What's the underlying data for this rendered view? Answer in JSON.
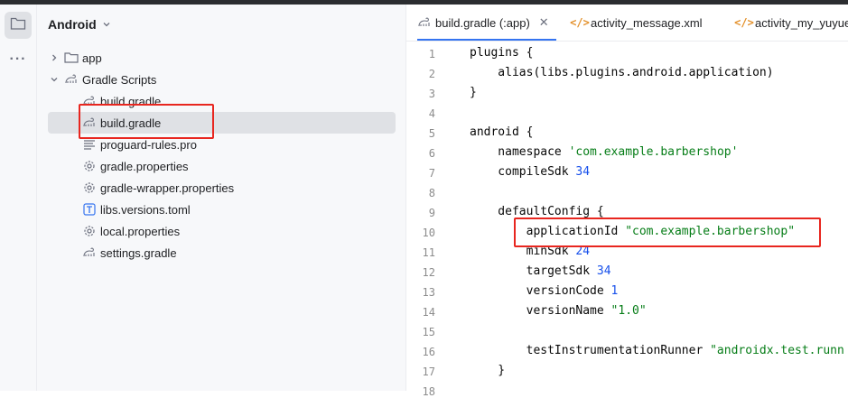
{
  "project_panel": {
    "title": "Android",
    "tree": [
      {
        "label": "app",
        "expanded": false,
        "icon": "folder-icon"
      },
      {
        "label": "Gradle Scripts",
        "expanded": true,
        "icon": "gradle-icon"
      },
      {
        "label": "build.gradle",
        "icon": "gradle-icon"
      },
      {
        "label": "build.gradle",
        "icon": "gradle-icon",
        "selected": true
      },
      {
        "label": "proguard-rules.pro",
        "icon": "text-file-icon"
      },
      {
        "label": "gradle.properties",
        "icon": "gear-icon"
      },
      {
        "label": "gradle-wrapper.properties",
        "icon": "gear-icon"
      },
      {
        "label": "libs.versions.toml",
        "icon": "toml-icon"
      },
      {
        "label": "local.properties",
        "icon": "gear-icon"
      },
      {
        "label": "settings.gradle",
        "icon": "gradle-icon"
      }
    ]
  },
  "tabs": [
    {
      "label": "build.gradle (:app)",
      "active": true,
      "icon": "gradle-icon"
    },
    {
      "label": "activity_message.xml",
      "icon": "xml-icon"
    },
    {
      "label": "activity_my_yuyue.",
      "icon": "xml-icon"
    }
  ],
  "editor": {
    "lines": [
      {
        "n": "1",
        "tokens": [
          {
            "t": "plugins {"
          }
        ]
      },
      {
        "n": "2",
        "tokens": [
          {
            "t": "    alias(libs.plugins.android.application)"
          }
        ]
      },
      {
        "n": "3",
        "tokens": [
          {
            "t": "}"
          }
        ]
      },
      {
        "n": "4",
        "tokens": []
      },
      {
        "n": "5",
        "tokens": [
          {
            "t": "android {"
          }
        ]
      },
      {
        "n": "6",
        "tokens": [
          {
            "t": "    namespace "
          },
          {
            "t": "'com.example.barbershop'",
            "c": "str"
          }
        ]
      },
      {
        "n": "7",
        "tokens": [
          {
            "t": "    compileSdk "
          },
          {
            "t": "34",
            "c": "num"
          }
        ]
      },
      {
        "n": "8",
        "tokens": []
      },
      {
        "n": "9",
        "tokens": [
          {
            "t": "    defaultConfig {"
          }
        ]
      },
      {
        "n": "10",
        "tokens": [
          {
            "t": "        applicationId "
          },
          {
            "t": "\"com.example.barbershop\"",
            "c": "str"
          }
        ]
      },
      {
        "n": "11",
        "tokens": [
          {
            "t": "        minSdk "
          },
          {
            "t": "24",
            "c": "num"
          }
        ]
      },
      {
        "n": "12",
        "tokens": [
          {
            "t": "        targetSdk "
          },
          {
            "t": "34",
            "c": "num"
          }
        ]
      },
      {
        "n": "13",
        "tokens": [
          {
            "t": "        versionCode "
          },
          {
            "t": "1",
            "c": "num"
          }
        ]
      },
      {
        "n": "14",
        "tokens": [
          {
            "t": "        versionName "
          },
          {
            "t": "\"1.0\"",
            "c": "str"
          }
        ]
      },
      {
        "n": "15",
        "tokens": []
      },
      {
        "n": "16",
        "tokens": [
          {
            "t": "        testInstrumentationRunner "
          },
          {
            "t": "\"androidx.test.runn",
            "c": "str"
          }
        ]
      },
      {
        "n": "17",
        "tokens": [
          {
            "t": "    }"
          }
        ]
      },
      {
        "n": "18",
        "tokens": []
      }
    ]
  },
  "colors": {
    "highlight_box": "#e8261f",
    "string": "#067d17",
    "number": "#1750eb",
    "tab_underline": "#3574f0"
  }
}
